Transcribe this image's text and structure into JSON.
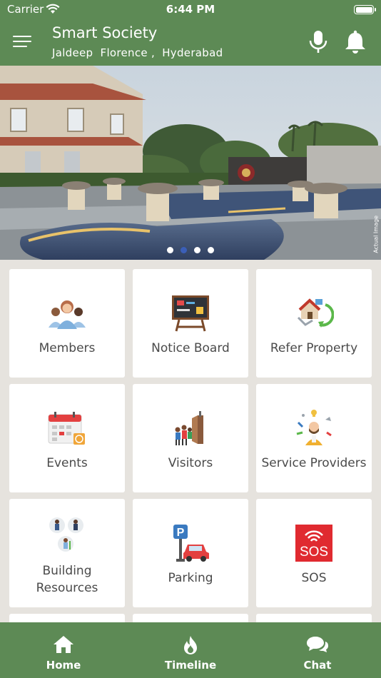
{
  "status_bar": {
    "carrier": "Carrier",
    "time": "6:44 PM"
  },
  "header": {
    "title": "Smart Society",
    "subtitle": "Jaldeep  Florence ,  Hyderabad",
    "menu_icon": "hamburger-icon",
    "mic_icon": "microphone-icon",
    "bell_icon": "bell-icon"
  },
  "banner": {
    "caption": "Actual Image",
    "slide_count": 4,
    "active_slide": 2
  },
  "tiles": [
    {
      "label": "Members",
      "icon": "members-icon"
    },
    {
      "label": "Notice Board",
      "icon": "notice-board-icon"
    },
    {
      "label": "Refer Property",
      "icon": "refer-property-icon"
    },
    {
      "label": "Events",
      "icon": "calendar-icon"
    },
    {
      "label": "Visitors",
      "icon": "visitors-icon"
    },
    {
      "label": "Service Providers",
      "icon": "service-providers-icon"
    },
    {
      "label_line1": "Building",
      "label_line2": "Resources",
      "icon": "building-resources-icon"
    },
    {
      "label": "Parking",
      "icon": "parking-icon"
    },
    {
      "label": "SOS",
      "icon": "sos-icon",
      "badge_text": "SOS"
    }
  ],
  "tab_bar": {
    "tabs": [
      {
        "label": "Home",
        "icon": "home-icon"
      },
      {
        "label": "Timeline",
        "icon": "flame-icon"
      },
      {
        "label": "Chat",
        "icon": "chat-icon"
      }
    ]
  },
  "colors": {
    "primary": "#5d8a55",
    "background": "#e6e3de",
    "tile": "#ffffff",
    "label": "#4a4a4a",
    "sos_red": "#e02a30",
    "dot_active": "#3b5fb8"
  }
}
